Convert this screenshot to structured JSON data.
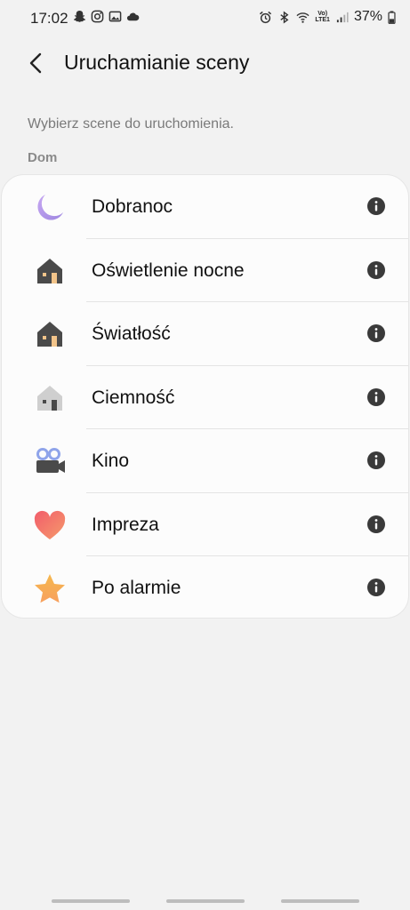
{
  "status": {
    "time": "17:02",
    "battery": "37%",
    "network": "LTE1",
    "volte": "Vo)"
  },
  "header": {
    "title": "Uruchamianie sceny"
  },
  "subtitle": "Wybierz scene do uruchomienia.",
  "section_title": "Dom",
  "scenes": [
    {
      "label": "Dobranoc",
      "icon": "moon-icon"
    },
    {
      "label": "Oświetlenie nocne",
      "icon": "house-light-icon"
    },
    {
      "label": "Światłość",
      "icon": "house-light-icon"
    },
    {
      "label": "Ciemność",
      "icon": "house-dark-icon"
    },
    {
      "label": "Kino",
      "icon": "camera-icon"
    },
    {
      "label": "Impreza",
      "icon": "heart-icon"
    },
    {
      "label": "Po alarmie",
      "icon": "star-icon"
    }
  ],
  "colors": {
    "background": "#f2f2f2",
    "card": "#fcfcfc",
    "moon": "#b59be8",
    "house": "#4a4a4a",
    "window": "#f2c48a",
    "heart": "#f26b6b",
    "star": "#f7c25e"
  }
}
